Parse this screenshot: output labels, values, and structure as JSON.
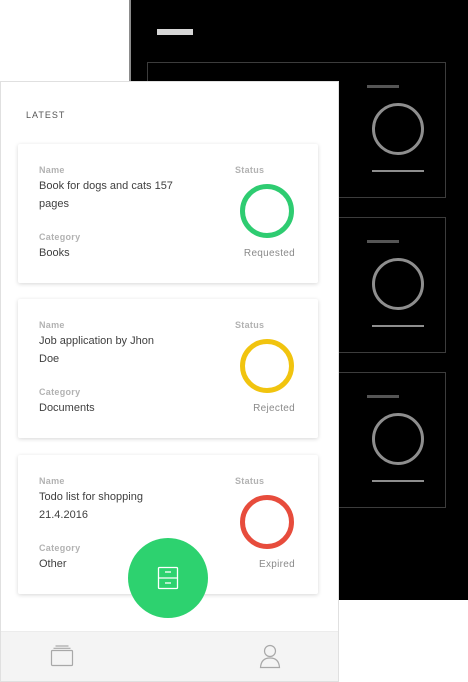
{
  "screen": {
    "section_title": "LATEST",
    "cards": [
      {
        "name_label": "Name",
        "name": "Book for dogs and cats 157 pages",
        "category_label": "Category",
        "category": "Books",
        "status_label": "Status",
        "status": "Requested",
        "status_color": "#2ecc71"
      },
      {
        "name_label": "Name",
        "name": "Job application by Jhon Doe",
        "category_label": "Category",
        "category": "Documents",
        "status_label": "Status",
        "status": "Rejected",
        "status_color": "#f1c40f"
      },
      {
        "name_label": "Name",
        "name": "Todo list for shopping 21.4.2016",
        "category_label": "Category",
        "category": "Other",
        "status_label": "Status",
        "status": "Expired",
        "status_color": "#e74c3c"
      }
    ]
  },
  "bottom_nav": {
    "items": [
      {
        "icon": "stack-icon"
      },
      {
        "icon": "archive-icon",
        "active": true,
        "color": "#2dd26f"
      },
      {
        "icon": "user-icon"
      }
    ]
  },
  "wireframe": {
    "icon": "close-box-icon"
  }
}
